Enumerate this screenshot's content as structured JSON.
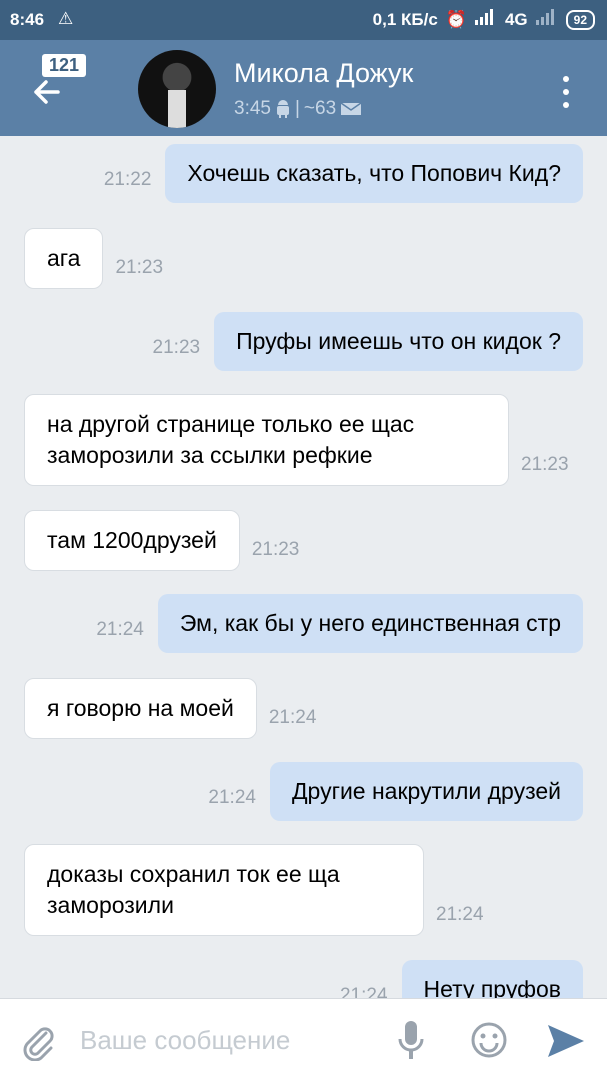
{
  "statusbar": {
    "time": "8:46",
    "warning_icon": "⚠",
    "network_speed": "0,1 КБ/с",
    "network": "4G",
    "battery": "92"
  },
  "header": {
    "unread_count": "121",
    "name": "Микола Дожук",
    "last_seen": "3:45",
    "separator": "|",
    "counter": "~63"
  },
  "messages": [
    {
      "dir": "out",
      "text": "Хочешь сказать, что Попович Кид?",
      "time": "21:22"
    },
    {
      "dir": "in",
      "text": "ага",
      "time": "21:23"
    },
    {
      "dir": "out",
      "text": "Пруфы имеешь что он кидок ?",
      "time": "21:23"
    },
    {
      "dir": "in",
      "text": "на другой странице только ее щас заморозили за ссылки рефкие",
      "time": "21:23"
    },
    {
      "dir": "in",
      "text": "там 1200друзей",
      "time": "21:23"
    },
    {
      "dir": "out",
      "text": "Эм, как бы у него единственная стр",
      "time": "21:24"
    },
    {
      "dir": "in",
      "text": "я говорю на моей",
      "time": "21:24"
    },
    {
      "dir": "out",
      "text": "Другие накрутили друзей",
      "time": "21:24"
    },
    {
      "dir": "in",
      "text": "доказы сохранил ток ее ща заморозили",
      "time": "21:24"
    },
    {
      "dir": "out",
      "text": "Нету пруфов",
      "time": "21:24"
    }
  ],
  "input": {
    "placeholder": "Ваше сообщение"
  },
  "colors": {
    "header": "#5b80a6",
    "statusbar": "#3d6080",
    "outgoing_bubble": "#cfe0f5",
    "incoming_bubble": "#ffffff",
    "background": "#eaedf0",
    "send": "#5b80a6"
  }
}
